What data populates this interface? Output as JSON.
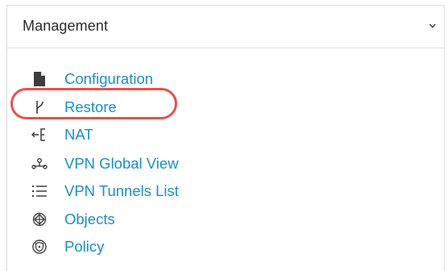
{
  "panel": {
    "title": "Management",
    "chevron_icon": "chevron-down-icon"
  },
  "menu": {
    "items": [
      {
        "label": "Configuration",
        "icon": "document-icon"
      },
      {
        "label": "Restore",
        "icon": "branch-icon"
      },
      {
        "label": "NAT",
        "icon": "nat-icon"
      },
      {
        "label": "VPN Global View",
        "icon": "topology-icon"
      },
      {
        "label": "VPN Tunnels List",
        "icon": "list-icon"
      },
      {
        "label": "Objects",
        "icon": "objects-icon"
      },
      {
        "label": "Policy",
        "icon": "shield-icon"
      }
    ]
  },
  "colors": {
    "link": "#1a8fc7",
    "icon": "#3d3d3d",
    "highlight": "#e5524d",
    "border": "#dcdcdc"
  }
}
